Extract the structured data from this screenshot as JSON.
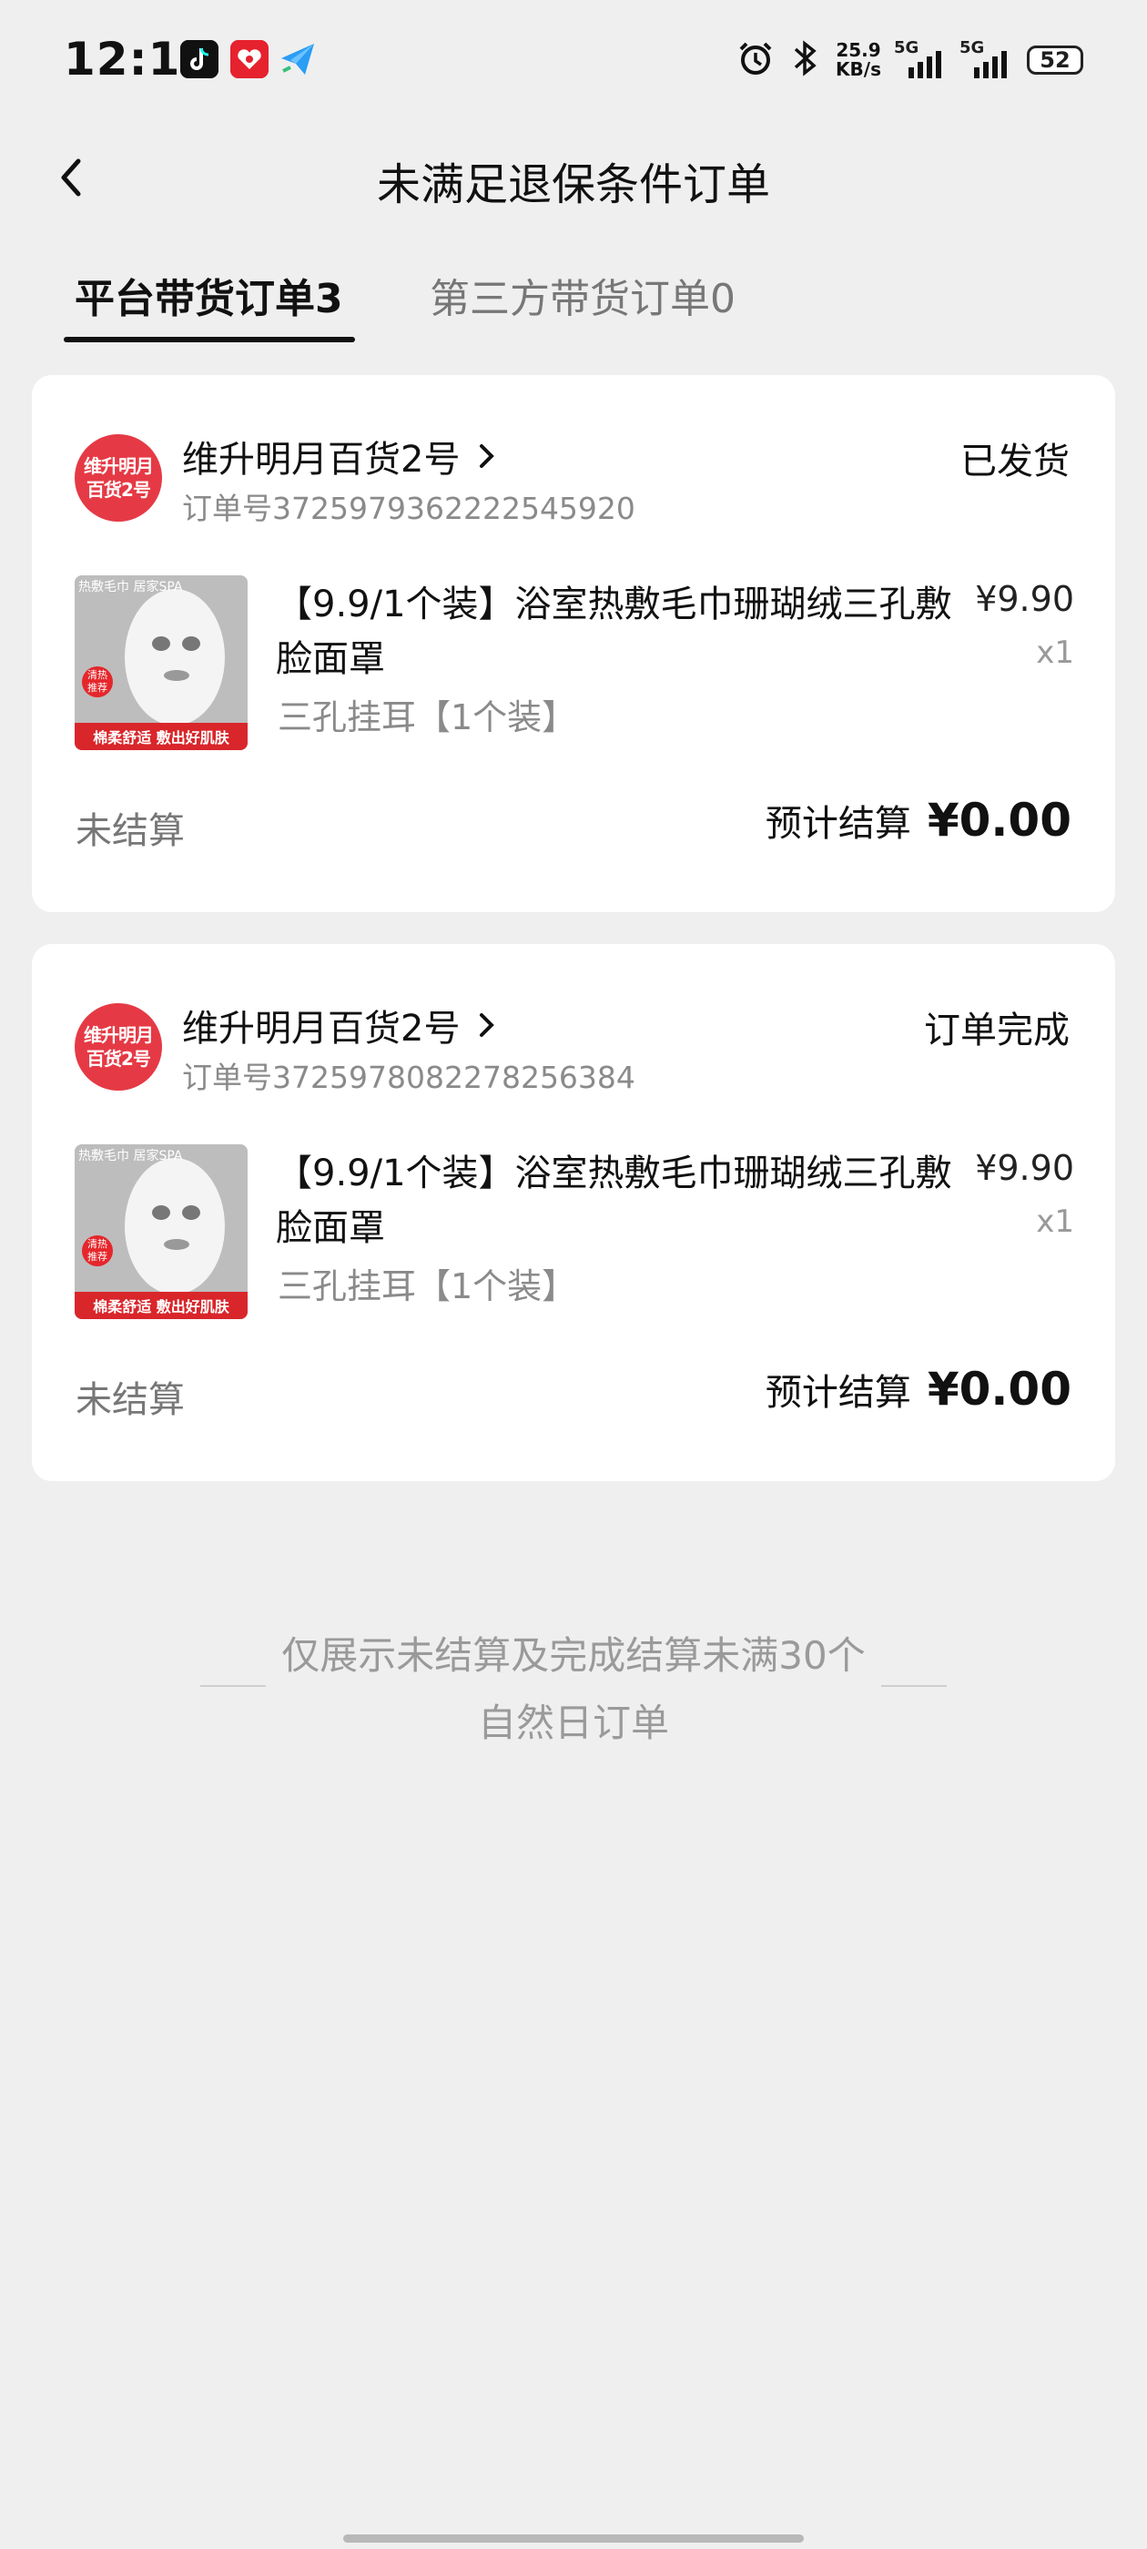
{
  "status_bar": {
    "time": "12:17",
    "net_speed_value": "25.9",
    "net_speed_unit": "KB/s",
    "sim1_label": "5G",
    "sim2_label": "5G",
    "battery": "52",
    "icons": [
      "tiktok-icon",
      "gift-icon",
      "send-icon",
      "alarm-icon",
      "bluetooth-icon",
      "signal-icon",
      "battery-icon"
    ]
  },
  "header": {
    "title": "未满足退保条件订单",
    "back_icon": "chevron-left-icon"
  },
  "tabs": [
    {
      "label": "平台带货订单3",
      "active": true
    },
    {
      "label": "第三方带货订单0",
      "active": false
    }
  ],
  "orders": [
    {
      "shop_name": "维升明月百货2号",
      "avatar_text": [
        "维升明月",
        "百货2号"
      ],
      "order_no": "订单号3725979362222545920",
      "status": "已发货",
      "product_title": "【9.9/1个装】浴室热敷毛巾珊瑚绒三孔敷脸面罩",
      "product_spec": "三孔挂耳【1个装】",
      "price": "¥9.90",
      "qty": "x1",
      "thumb_text": "热敷毛巾 居家SPA",
      "thumb_banner": "棉柔舒适 敷出好肌肤",
      "settle_status": "未结算",
      "estimated_label": "预计结算",
      "estimated_amount": "¥0.00"
    },
    {
      "shop_name": "维升明月百货2号",
      "avatar_text": [
        "维升明月",
        "百货2号"
      ],
      "order_no": "订单号3725978082278256384",
      "status": "订单完成",
      "product_title": "【9.9/1个装】浴室热敷毛巾珊瑚绒三孔敷脸面罩",
      "product_spec": "三孔挂耳【1个装】",
      "price": "¥9.90",
      "qty": "x1",
      "thumb_text": "热敷毛巾 居家SPA",
      "thumb_banner": "棉柔舒适 敷出好肌肤",
      "settle_status": "未结算",
      "estimated_label": "预计结算",
      "estimated_amount": "¥0.00"
    }
  ],
  "footer_note": "仅展示未结算及完成结算未满30个自然日订单",
  "colors": {
    "background": "#efefef",
    "card": "#ffffff",
    "brand_red": "#e53a45",
    "text_primary": "#111111",
    "text_secondary": "#8a8a8a"
  }
}
